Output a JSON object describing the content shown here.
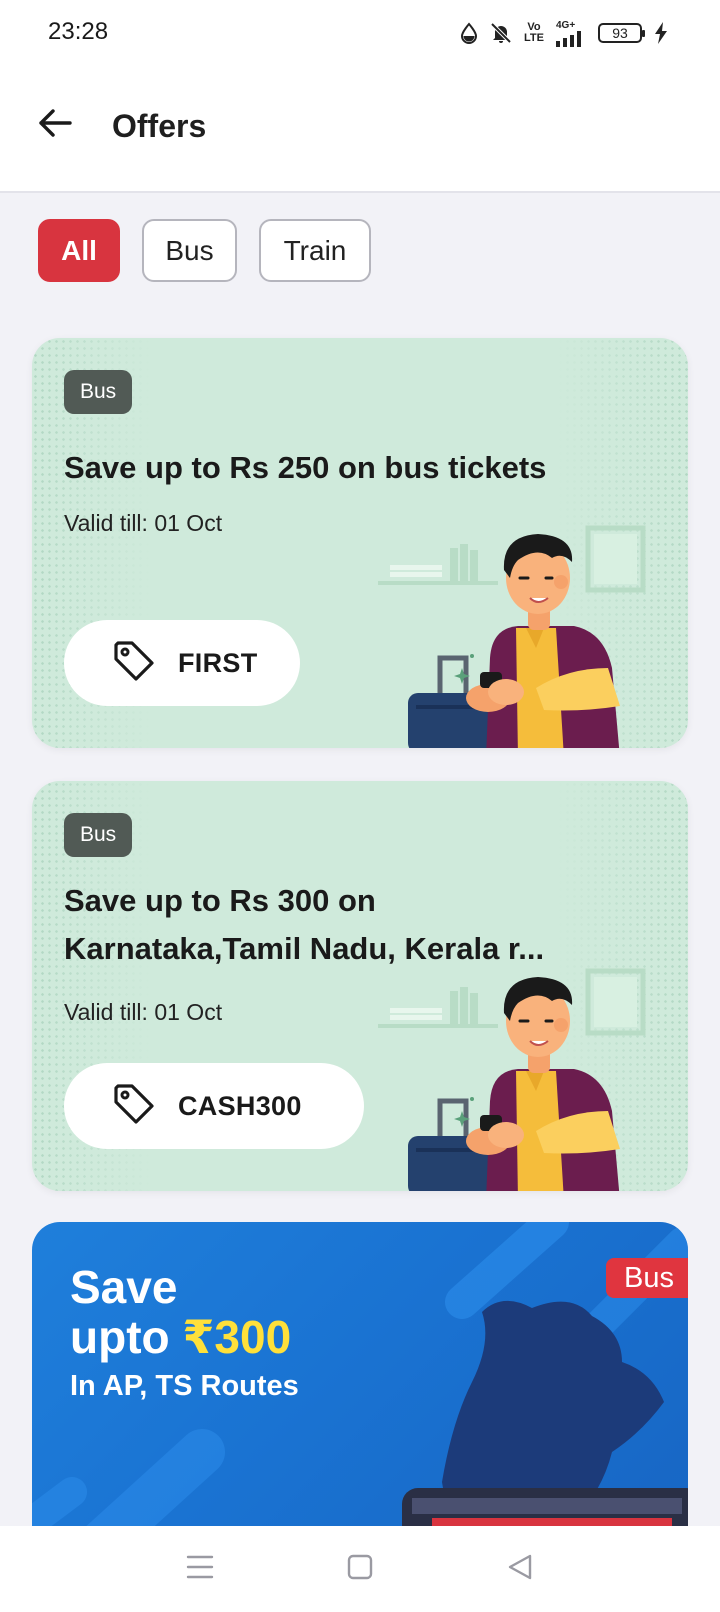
{
  "status_bar": {
    "time": "23:28",
    "network_label_top": "Vo",
    "network_label_bottom": "LTE",
    "network_type": "4G+",
    "battery": "93",
    "icons": [
      "water-drop-icon",
      "bell-muted-icon",
      "volte-icon",
      "signal-icon",
      "battery-icon",
      "charging-bolt-icon"
    ]
  },
  "app_bar": {
    "title": "Offers",
    "back_icon": "arrow-left-icon"
  },
  "filters": {
    "chips": [
      {
        "label": "All",
        "active": true
      },
      {
        "label": "Bus",
        "active": false
      },
      {
        "label": "Train",
        "active": false
      }
    ]
  },
  "offers": [
    {
      "tag": "Bus",
      "title": "Save up to Rs 250 on bus tickets",
      "valid": "Valid till: 01 Oct",
      "code": "FIRST",
      "code_icon": "tag-icon"
    },
    {
      "tag": "Bus",
      "title_line1": "Save up to Rs 300 on",
      "title_line2": "Karnataka,Tamil Nadu, Kerala r...",
      "valid": "Valid till: 01 Oct",
      "code": "CASH300",
      "code_icon": "tag-icon"
    }
  ],
  "banner": {
    "line1": "Save",
    "line2_prefix": "upto ",
    "amount": "₹300",
    "line3": "In AP, TS Routes",
    "tag": "Bus"
  },
  "nav_bar": {
    "icons": [
      "menu-icon",
      "home-square-icon",
      "back-triangle-icon"
    ]
  },
  "colors": {
    "accent_red": "#d8343f",
    "card_green": "#cfeadb",
    "banner_blue": "#1a73d2",
    "banner_yellow": "#ffe03a",
    "tag_dark": "#515a55"
  }
}
